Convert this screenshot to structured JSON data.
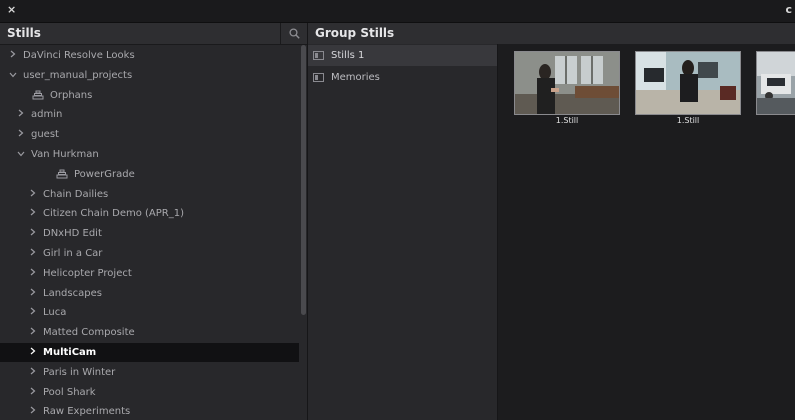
{
  "window": {
    "close_glyph": "×",
    "edge_glyph": "c"
  },
  "stills_panel": {
    "title": "Stills",
    "search_icon": "search-icon",
    "tree": [
      {
        "label": "DaVinci Resolve Looks",
        "chevron": ">",
        "indent": 0
      },
      {
        "label": "user_manual_projects",
        "chevron": "v",
        "indent": 0
      },
      {
        "label": "Orphans",
        "icon": "stack-icon",
        "indent": 1
      },
      {
        "label": "admin",
        "chevron": ">",
        "indent": 1
      },
      {
        "label": "guest",
        "chevron": ">",
        "indent": 1
      },
      {
        "label": "Van Hurkman",
        "chevron": "v",
        "indent": 1
      },
      {
        "label": "PowerGrade",
        "icon": "stack-icon",
        "indent": 2
      },
      {
        "label": "Chain Dailies",
        "chevron": ">",
        "indent": 2
      },
      {
        "label": "Citizen Chain Demo (APR_1)",
        "chevron": ">",
        "indent": 2
      },
      {
        "label": "DNxHD Edit",
        "chevron": ">",
        "indent": 2
      },
      {
        "label": "Girl in a Car",
        "chevron": ">",
        "indent": 2
      },
      {
        "label": "Helicopter Project",
        "chevron": ">",
        "indent": 2
      },
      {
        "label": "Landscapes",
        "chevron": ">",
        "indent": 2
      },
      {
        "label": "Luca",
        "chevron": ">",
        "indent": 2
      },
      {
        "label": "Matted Composite",
        "chevron": ">",
        "indent": 2
      },
      {
        "label": "MultiCam",
        "chevron": ">",
        "indent": 2,
        "selected": true
      },
      {
        "label": "Paris in Winter",
        "chevron": ">",
        "indent": 2
      },
      {
        "label": "Pool Shark",
        "chevron": ">",
        "indent": 2
      },
      {
        "label": "Raw Experiments",
        "chevron": ">",
        "indent": 2
      }
    ]
  },
  "group_stills": {
    "title": "Group Stills",
    "items": [
      {
        "label": "Stills 1",
        "active": true
      },
      {
        "label": "Memories",
        "active": false
      }
    ]
  },
  "stills": [
    {
      "label": "1.Still"
    },
    {
      "label": "1.Still"
    },
    {
      "label": ""
    }
  ],
  "colors": {
    "selected_row": "#111113",
    "panel_bg": "#28282b",
    "viewer_bg": "#1c1c1e"
  }
}
